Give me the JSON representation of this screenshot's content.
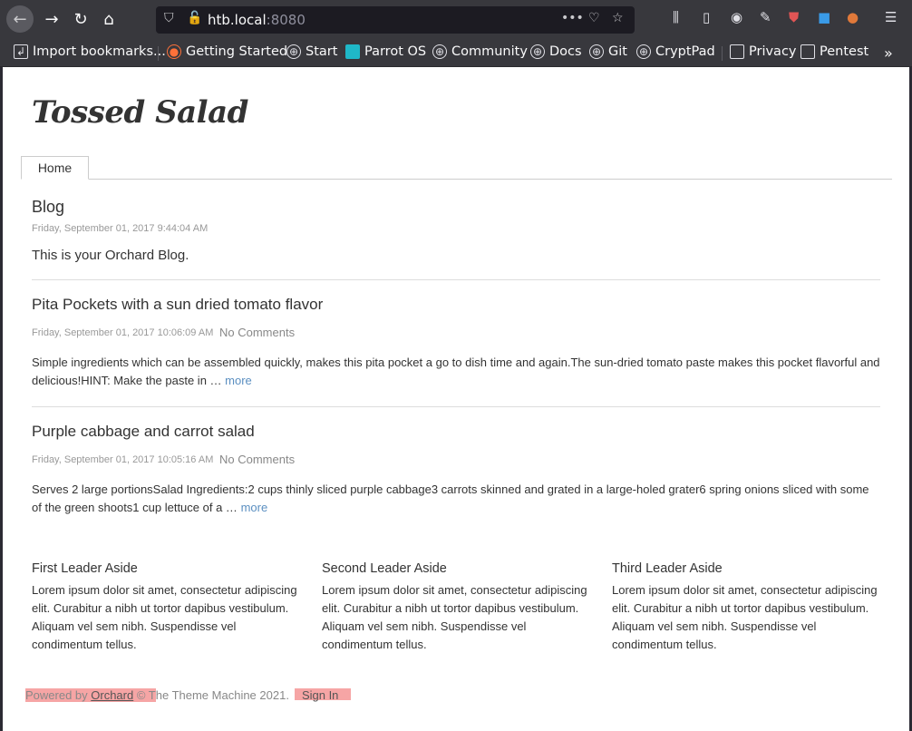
{
  "browser": {
    "url_host": "htb.local",
    "url_port": ":8080",
    "bookmarks": [
      "Import bookmarks...",
      "Getting Started",
      "Start",
      "Parrot OS",
      "Community",
      "Docs",
      "Git",
      "CryptPad",
      "Privacy",
      "Pentest"
    ]
  },
  "site": {
    "brand": "Tossed Salad",
    "nav": {
      "home": "Home"
    }
  },
  "blog": {
    "title": "Blog",
    "date": "Friday, September 01, 2017 9:44:04 AM",
    "description": "This is your Orchard Blog."
  },
  "posts": [
    {
      "title": "Pita Pockets with a sun dried tomato flavor",
      "date": "Friday, September 01, 2017 10:06:09 AM",
      "comments": "No Comments",
      "excerpt": "Simple ingredients which can be assembled quickly, makes this pita pocket a go to dish time and again.The sun-dried tomato paste makes this pocket flavorful and delicious!HINT:  Make the paste in …",
      "more": "more"
    },
    {
      "title": "Purple cabbage and carrot salad",
      "date": "Friday, September 01, 2017 10:05:16 AM",
      "comments": "No Comments",
      "excerpt": "Serves 2 large portionsSalad Ingredients:2 cups thinly sliced purple cabbage3 carrots skinned and grated in a large-holed grater6 spring onions sliced with some of the green shoots1 cup lettuce of a …",
      "more": "more"
    }
  ],
  "asides": [
    {
      "title": "First Leader Aside",
      "text": "Lorem ipsum dolor sit amet, consectetur adipiscing elit. Curabitur a nibh ut tortor dapibus vestibulum. Aliquam vel sem nibh. Suspendisse vel condimentum tellus."
    },
    {
      "title": "Second Leader Aside",
      "text": "Lorem ipsum dolor sit amet, consectetur adipiscing elit. Curabitur a nibh ut tortor dapibus vestibulum. Aliquam vel sem nibh. Suspendisse vel condimentum tellus."
    },
    {
      "title": "Third Leader Aside",
      "text": "Lorem ipsum dolor sit amet, consectetur adipiscing elit. Curabitur a nibh ut tortor dapibus vestibulum. Aliquam vel sem nibh. Suspendisse vel condimentum tellus."
    }
  ],
  "footer": {
    "powered_by": "Powered by ",
    "orchard": "Orchard",
    "copyright": " © The Theme Machine 2021.",
    "sign_in": "Sign In"
  },
  "colors": {
    "chrome": "#38383d",
    "highlight": "#f6a5a5",
    "link": "#5b8fc1"
  }
}
